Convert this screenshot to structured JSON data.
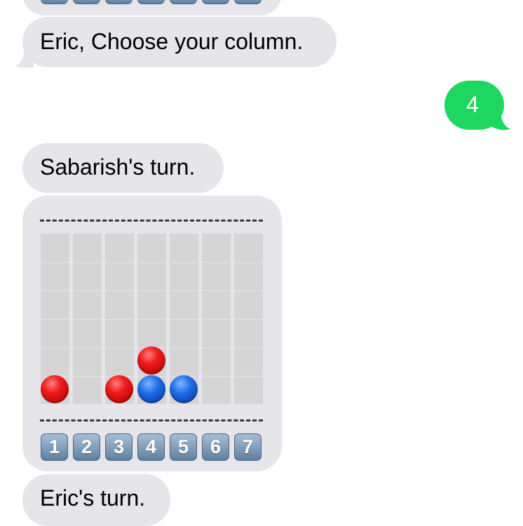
{
  "messages": {
    "choose_prompt": "Eric, Choose your column.",
    "sent_reply": "4",
    "sabarish_turn": "Sabarish's turn.",
    "eric_turn": "Eric's turn."
  },
  "board": {
    "top_rule": "---------------------",
    "bottom_rule": "---------------------",
    "columns": 7,
    "rows": 6,
    "discs": [
      {
        "column": 1,
        "row_from_bottom": 1,
        "color": "red"
      },
      {
        "column": 3,
        "row_from_bottom": 1,
        "color": "red"
      },
      {
        "column": 4,
        "row_from_bottom": 1,
        "color": "blue"
      },
      {
        "column": 4,
        "row_from_bottom": 2,
        "color": "red"
      },
      {
        "column": 5,
        "row_from_bottom": 1,
        "color": "blue"
      }
    ],
    "column_keys": [
      "1",
      "2",
      "3",
      "4",
      "5",
      "6",
      "7"
    ]
  },
  "colors": {
    "received_bubble": "#e5e5ea",
    "sent_bubble": "#1ed760",
    "red_disc": "#e01010",
    "blue_disc": "#1a5fd6",
    "empty_column": "#d5d5d5"
  }
}
